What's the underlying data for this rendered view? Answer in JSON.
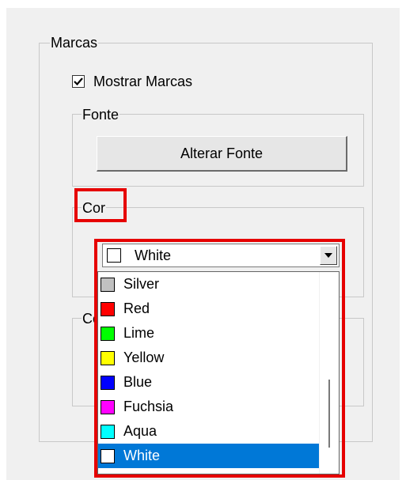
{
  "marcas": {
    "legend": "Marcas",
    "show_marks": {
      "label": "Mostrar Marcas",
      "checked": true
    }
  },
  "fonte": {
    "legend": "Fonte",
    "button_label": "Alterar Fonte"
  },
  "cor": {
    "legend": "Cor",
    "selected": {
      "label": "White",
      "color": "#ffffff"
    },
    "options": [
      {
        "label": "Silver",
        "color": "#c0c0c0"
      },
      {
        "label": "Red",
        "color": "#ff0000"
      },
      {
        "label": "Lime",
        "color": "#00ff00"
      },
      {
        "label": "Yellow",
        "color": "#ffff00"
      },
      {
        "label": "Blue",
        "color": "#0000ff"
      },
      {
        "label": "Fuchsia",
        "color": "#ff00ff"
      },
      {
        "label": "Aqua",
        "color": "#00ffff"
      },
      {
        "label": "White",
        "color": "#ffffff",
        "selected": true
      }
    ]
  },
  "obscured_group": {
    "legend_visible_fragment": "Co"
  },
  "colors": {
    "highlight": "#e60000",
    "selection": "#0078d7",
    "panel": "#f0f0f0"
  }
}
